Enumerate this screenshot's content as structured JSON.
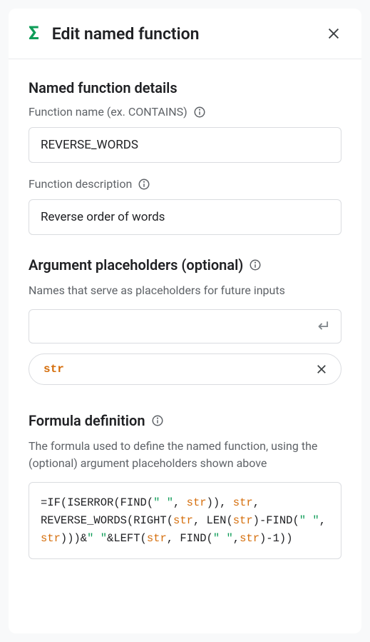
{
  "header": {
    "title": "Edit named function"
  },
  "details": {
    "heading": "Named function details",
    "name_label": "Function name (ex. CONTAINS)",
    "name_value": "REVERSE_WORDS",
    "desc_label": "Function description",
    "desc_value": "Reverse order of words"
  },
  "args": {
    "heading": "Argument placeholders (optional)",
    "helper": "Names that serve as placeholders for future inputs",
    "chip": "str"
  },
  "formula": {
    "heading": "Formula definition",
    "helper": "The formula used to define the named function, using the (optional) argument placeholders shown above",
    "tokens": [
      {
        "t": "=IF(ISERROR(FIND(",
        "c": ""
      },
      {
        "t": "\" \"",
        "c": "str"
      },
      {
        "t": ", ",
        "c": ""
      },
      {
        "t": "str",
        "c": "arg"
      },
      {
        "t": ")), ",
        "c": ""
      },
      {
        "t": "str",
        "c": "arg"
      },
      {
        "t": ", REVERSE_WORDS(RIGHT(",
        "c": ""
      },
      {
        "t": "str",
        "c": "arg"
      },
      {
        "t": ", LEN(",
        "c": ""
      },
      {
        "t": "str",
        "c": "arg"
      },
      {
        "t": ")-FIND(",
        "c": ""
      },
      {
        "t": "\" \"",
        "c": "str"
      },
      {
        "t": ", ",
        "c": ""
      },
      {
        "t": "str",
        "c": "arg"
      },
      {
        "t": ")))&",
        "c": ""
      },
      {
        "t": "\" \"",
        "c": "str"
      },
      {
        "t": "&LEFT(",
        "c": ""
      },
      {
        "t": "str",
        "c": "arg"
      },
      {
        "t": ", FIND(",
        "c": ""
      },
      {
        "t": "\" \"",
        "c": "str"
      },
      {
        "t": ",",
        "c": ""
      },
      {
        "t": "str",
        "c": "arg"
      },
      {
        "t": ")-1))",
        "c": ""
      }
    ]
  }
}
